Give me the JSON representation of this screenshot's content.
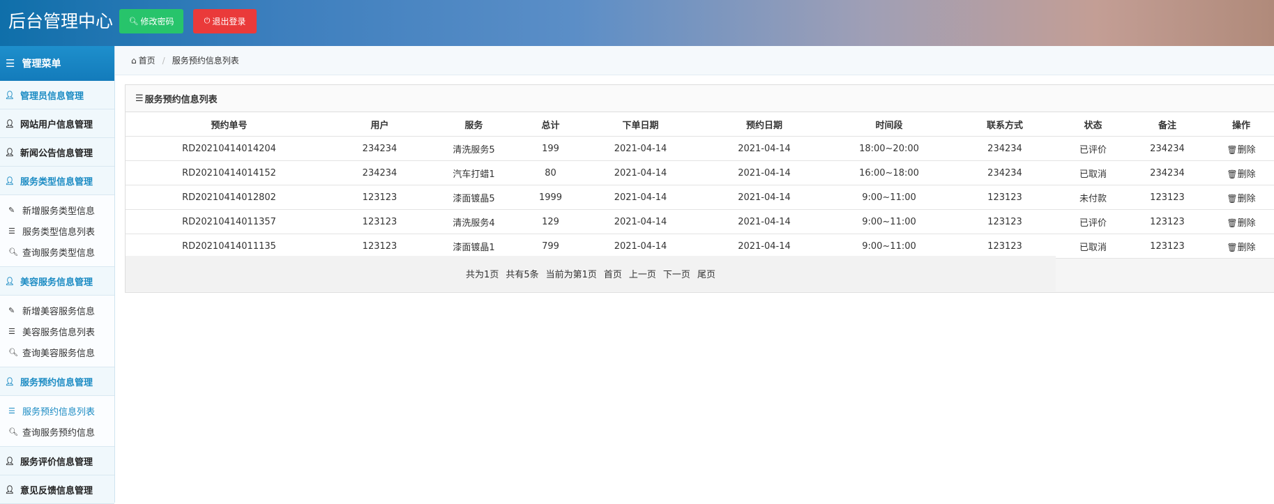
{
  "header": {
    "title": "后台管理中心",
    "change_password": "修改密码",
    "logout": "退出登录"
  },
  "sidebar": {
    "menu_title": "管理菜单",
    "groups": [
      {
        "label": "管理员信息管理",
        "color": "blue"
      },
      {
        "label": "网站用户信息管理"
      },
      {
        "label": "新闻公告信息管理"
      },
      {
        "label": "服务类型信息管理",
        "color": "blue",
        "items": [
          "新增服务类型信息",
          "服务类型信息列表",
          "查询服务类型信息"
        ]
      },
      {
        "label": "美容服务信息管理",
        "color": "blue",
        "items": [
          "新增美容服务信息",
          "美容服务信息列表",
          "查询美容服务信息"
        ]
      },
      {
        "label": "服务预约信息管理",
        "color": "blue",
        "items": [
          "服务预约信息列表",
          "查询服务预约信息"
        ]
      },
      {
        "label": "服务评价信息管理"
      },
      {
        "label": "意见反馈信息管理"
      }
    ]
  },
  "breadcrumb": {
    "home": "首页",
    "current": "服务预约信息列表"
  },
  "panel": {
    "title": "服务预约信息列表"
  },
  "table": {
    "headers": [
      "预约单号",
      "用户",
      "服务",
      "总计",
      "下单日期",
      "预约日期",
      "时间段",
      "联系方式",
      "状态",
      "备注",
      "操作"
    ],
    "rows": [
      [
        "RD20210414014204",
        "234234",
        "清洗服务5",
        "199",
        "2021-04-14",
        "2021-04-14",
        "18:00~20:00",
        "234234",
        "已评价",
        "234234",
        "删除"
      ],
      [
        "RD20210414014152",
        "234234",
        "汽车打蜡1",
        "80",
        "2021-04-14",
        "2021-04-14",
        "16:00~18:00",
        "234234",
        "已取消",
        "234234",
        "删除"
      ],
      [
        "RD20210414012802",
        "123123",
        "漆面镀晶5",
        "1999",
        "2021-04-14",
        "2021-04-14",
        "9:00~11:00",
        "123123",
        "未付款",
        "123123",
        "删除"
      ],
      [
        "RD20210414011357",
        "123123",
        "清洗服务4",
        "129",
        "2021-04-14",
        "2021-04-14",
        "9:00~11:00",
        "123123",
        "已评价",
        "123123",
        "删除"
      ],
      [
        "RD20210414011135",
        "123123",
        "漆面镀晶1",
        "799",
        "2021-04-14",
        "2021-04-14",
        "9:00~11:00",
        "123123",
        "已取消",
        "123123",
        "删除"
      ]
    ]
  },
  "pager": {
    "total_pages": "共为1页",
    "total_items": "共有5条",
    "current": "当前为第1页",
    "first": "首页",
    "prev": "上一页",
    "next": "下一页",
    "last": "尾页"
  },
  "colors": {
    "accent": "#1b8bc3",
    "green": "#27c46b",
    "red": "#ea3a3a"
  }
}
